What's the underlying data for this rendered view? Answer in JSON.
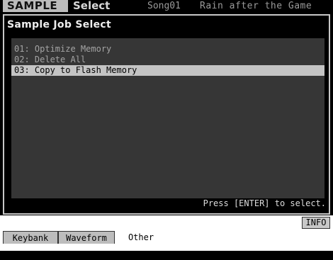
{
  "header": {
    "mode": "SAMPLE",
    "title": "Select",
    "song_id": "Song01",
    "song_name": "Rain after the Game"
  },
  "dialog": {
    "title": "Sample Job Select",
    "items": [
      {
        "label": "01: Optimize Memory",
        "selected": false
      },
      {
        "label": "02: Delete All",
        "selected": false
      },
      {
        "label": "03: Copy to Flash Memory",
        "selected": true
      }
    ],
    "hint": "Press [ENTER] to select."
  },
  "footer": {
    "info_label": "INFO",
    "tabs": [
      {
        "label": "Keybank",
        "active": false
      },
      {
        "label": "Waveform",
        "active": false
      },
      {
        "label": "Other",
        "active": true
      }
    ]
  }
}
